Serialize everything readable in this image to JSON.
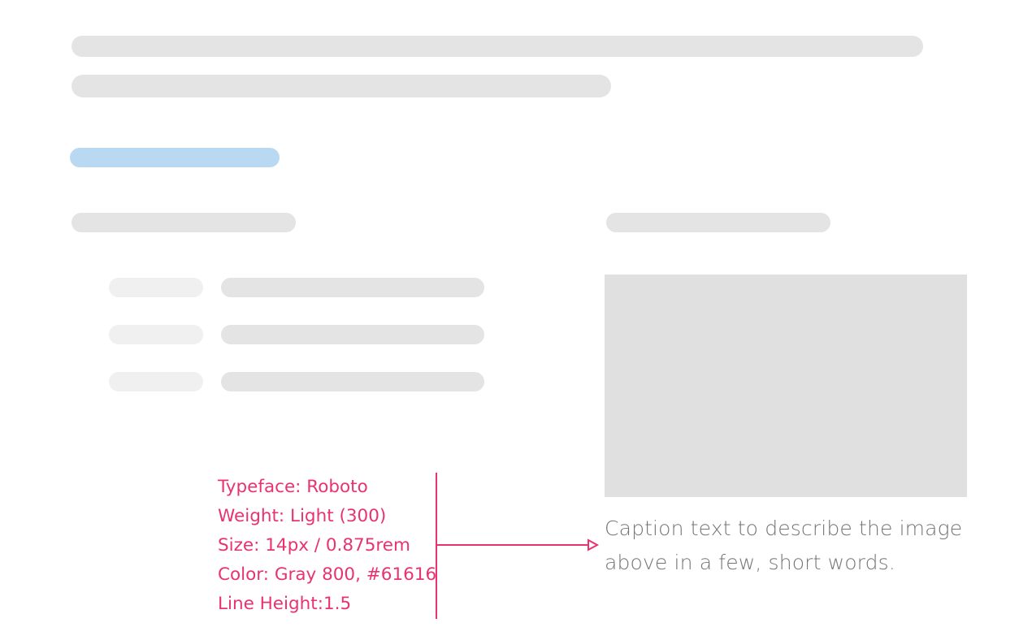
{
  "annotation": {
    "color": "#e8336f",
    "lines": [
      "Typeface: Roboto",
      "Weight: Light (300)",
      "Size: 14px / 0.875rem",
      "Color: Gray 800, #61616",
      "Line Height:1.5"
    ]
  },
  "figure": {
    "caption": "Caption text to describe the image above in a few, short words."
  },
  "colors": {
    "placeholder_bar": "#e4e4e4",
    "placeholder_bar_light": "#f0f0f0",
    "accent_bar": "#b9d8f1",
    "image_placeholder": "#e0e0e0",
    "caption_text": "#757575"
  }
}
